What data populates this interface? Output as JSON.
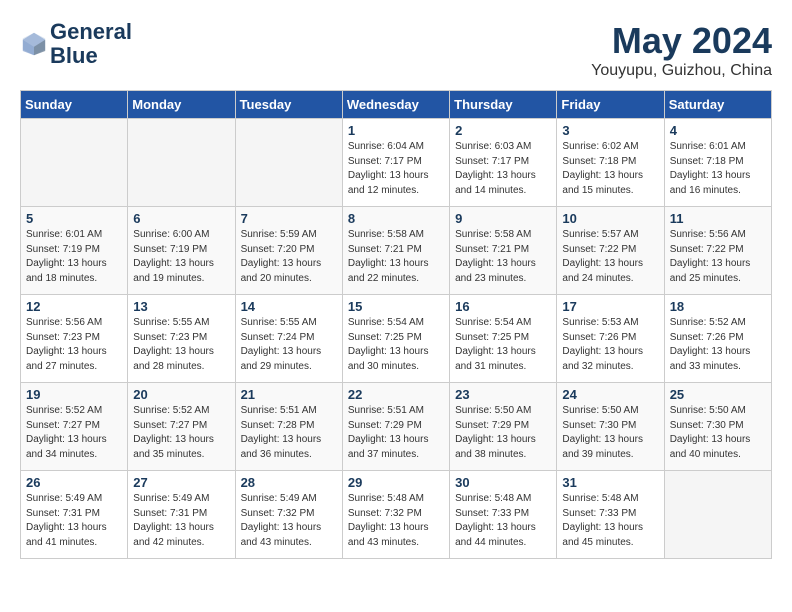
{
  "header": {
    "logo_line1": "General",
    "logo_line2": "Blue",
    "month": "May 2024",
    "location": "Youyupu, Guizhou, China"
  },
  "days_of_week": [
    "Sunday",
    "Monday",
    "Tuesday",
    "Wednesday",
    "Thursday",
    "Friday",
    "Saturday"
  ],
  "weeks": [
    [
      {
        "day": "",
        "empty": true
      },
      {
        "day": "",
        "empty": true
      },
      {
        "day": "",
        "empty": true
      },
      {
        "day": "1",
        "sunrise": "6:04 AM",
        "sunset": "7:17 PM",
        "daylight": "13 hours and 12 minutes."
      },
      {
        "day": "2",
        "sunrise": "6:03 AM",
        "sunset": "7:17 PM",
        "daylight": "13 hours and 14 minutes."
      },
      {
        "day": "3",
        "sunrise": "6:02 AM",
        "sunset": "7:18 PM",
        "daylight": "13 hours and 15 minutes."
      },
      {
        "day": "4",
        "sunrise": "6:01 AM",
        "sunset": "7:18 PM",
        "daylight": "13 hours and 16 minutes."
      }
    ],
    [
      {
        "day": "5",
        "sunrise": "6:01 AM",
        "sunset": "7:19 PM",
        "daylight": "13 hours and 18 minutes."
      },
      {
        "day": "6",
        "sunrise": "6:00 AM",
        "sunset": "7:19 PM",
        "daylight": "13 hours and 19 minutes."
      },
      {
        "day": "7",
        "sunrise": "5:59 AM",
        "sunset": "7:20 PM",
        "daylight": "13 hours and 20 minutes."
      },
      {
        "day": "8",
        "sunrise": "5:58 AM",
        "sunset": "7:21 PM",
        "daylight": "13 hours and 22 minutes."
      },
      {
        "day": "9",
        "sunrise": "5:58 AM",
        "sunset": "7:21 PM",
        "daylight": "13 hours and 23 minutes."
      },
      {
        "day": "10",
        "sunrise": "5:57 AM",
        "sunset": "7:22 PM",
        "daylight": "13 hours and 24 minutes."
      },
      {
        "day": "11",
        "sunrise": "5:56 AM",
        "sunset": "7:22 PM",
        "daylight": "13 hours and 25 minutes."
      }
    ],
    [
      {
        "day": "12",
        "sunrise": "5:56 AM",
        "sunset": "7:23 PM",
        "daylight": "13 hours and 27 minutes."
      },
      {
        "day": "13",
        "sunrise": "5:55 AM",
        "sunset": "7:23 PM",
        "daylight": "13 hours and 28 minutes."
      },
      {
        "day": "14",
        "sunrise": "5:55 AM",
        "sunset": "7:24 PM",
        "daylight": "13 hours and 29 minutes."
      },
      {
        "day": "15",
        "sunrise": "5:54 AM",
        "sunset": "7:25 PM",
        "daylight": "13 hours and 30 minutes."
      },
      {
        "day": "16",
        "sunrise": "5:54 AM",
        "sunset": "7:25 PM",
        "daylight": "13 hours and 31 minutes."
      },
      {
        "day": "17",
        "sunrise": "5:53 AM",
        "sunset": "7:26 PM",
        "daylight": "13 hours and 32 minutes."
      },
      {
        "day": "18",
        "sunrise": "5:52 AM",
        "sunset": "7:26 PM",
        "daylight": "13 hours and 33 minutes."
      }
    ],
    [
      {
        "day": "19",
        "sunrise": "5:52 AM",
        "sunset": "7:27 PM",
        "daylight": "13 hours and 34 minutes."
      },
      {
        "day": "20",
        "sunrise": "5:52 AM",
        "sunset": "7:27 PM",
        "daylight": "13 hours and 35 minutes."
      },
      {
        "day": "21",
        "sunrise": "5:51 AM",
        "sunset": "7:28 PM",
        "daylight": "13 hours and 36 minutes."
      },
      {
        "day": "22",
        "sunrise": "5:51 AM",
        "sunset": "7:29 PM",
        "daylight": "13 hours and 37 minutes."
      },
      {
        "day": "23",
        "sunrise": "5:50 AM",
        "sunset": "7:29 PM",
        "daylight": "13 hours and 38 minutes."
      },
      {
        "day": "24",
        "sunrise": "5:50 AM",
        "sunset": "7:30 PM",
        "daylight": "13 hours and 39 minutes."
      },
      {
        "day": "25",
        "sunrise": "5:50 AM",
        "sunset": "7:30 PM",
        "daylight": "13 hours and 40 minutes."
      }
    ],
    [
      {
        "day": "26",
        "sunrise": "5:49 AM",
        "sunset": "7:31 PM",
        "daylight": "13 hours and 41 minutes."
      },
      {
        "day": "27",
        "sunrise": "5:49 AM",
        "sunset": "7:31 PM",
        "daylight": "13 hours and 42 minutes."
      },
      {
        "day": "28",
        "sunrise": "5:49 AM",
        "sunset": "7:32 PM",
        "daylight": "13 hours and 43 minutes."
      },
      {
        "day": "29",
        "sunrise": "5:48 AM",
        "sunset": "7:32 PM",
        "daylight": "13 hours and 43 minutes."
      },
      {
        "day": "30",
        "sunrise": "5:48 AM",
        "sunset": "7:33 PM",
        "daylight": "13 hours and 44 minutes."
      },
      {
        "day": "31",
        "sunrise": "5:48 AM",
        "sunset": "7:33 PM",
        "daylight": "13 hours and 45 minutes."
      },
      {
        "day": "",
        "empty": true
      }
    ]
  ]
}
